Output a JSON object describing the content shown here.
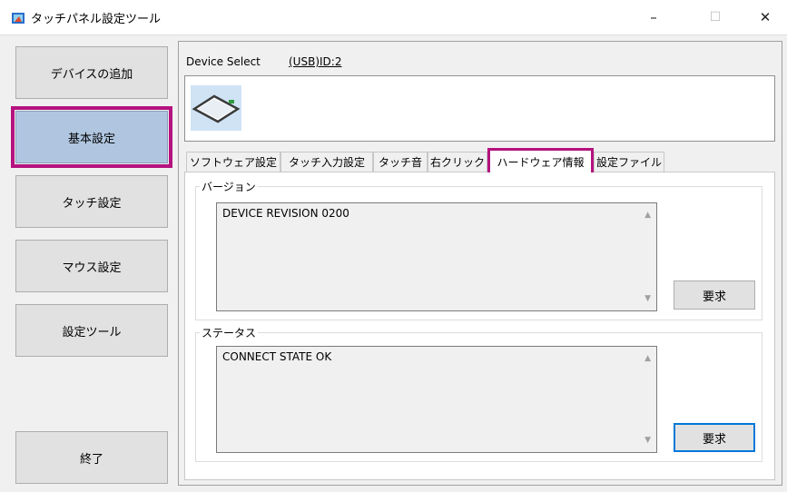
{
  "window": {
    "title": "タッチパネル設定ツール",
    "minimize_glyph": "–",
    "maximize_glyph": "☐",
    "close_glyph": "✕"
  },
  "sidebar": {
    "items": [
      {
        "label": "デバイスの追加"
      },
      {
        "label": "基本設定"
      },
      {
        "label": "タッチ設定"
      },
      {
        "label": "マウス設定"
      },
      {
        "label": "設定ツール"
      },
      {
        "label": "終了"
      }
    ],
    "selected": "基本設定"
  },
  "device": {
    "label": "Device Select",
    "value": "(USB)ID:2",
    "icon": "touch-panel-device-icon"
  },
  "tabs": [
    {
      "label": "ソフトウェア設定"
    },
    {
      "label": "タッチ入力設定"
    },
    {
      "label": "タッチ音"
    },
    {
      "label": "右クリック"
    },
    {
      "label": "ハードウェア情報"
    },
    {
      "label": "設定ファイル"
    }
  ],
  "active_tab": "ハードウェア情報",
  "version_group": {
    "title": "バージョン",
    "text": "DEVICE REVISION 0200",
    "button": "要求"
  },
  "status_group": {
    "title": "ステータス",
    "text": "CONNECT STATE OK",
    "button": "要求"
  },
  "colors": {
    "highlight": "#b5137f",
    "selected_sidebar": "#b0c6e0",
    "focus": "#0078d7"
  }
}
